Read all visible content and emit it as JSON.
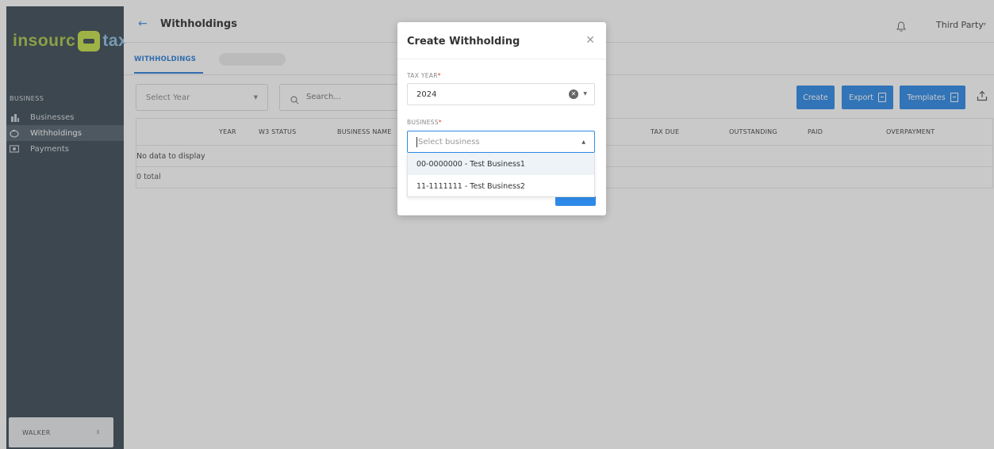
{
  "app": {
    "logo_text_1": "insourc",
    "logo_text_2": "tax",
    "brand_colors": {
      "sidebar": "#3d4b57",
      "accent": "#2f8ae8",
      "logo_green": "#c5e04a"
    }
  },
  "sidebar": {
    "section_label": "BUSINESS",
    "items": [
      {
        "label": "Businesses",
        "icon": "building-icon",
        "active": false
      },
      {
        "label": "Withholdings",
        "icon": "piggy-bank-icon",
        "active": true
      },
      {
        "label": "Payments",
        "icon": "money-icon",
        "active": false
      }
    ],
    "user": "WALKER"
  },
  "header": {
    "title": "Withholdings",
    "user_menu": "Third Party"
  },
  "tabs": [
    {
      "label": "WITHHOLDINGS",
      "active": true
    }
  ],
  "filters": {
    "year_placeholder": "Select Year",
    "search_placeholder": "Search..."
  },
  "toolbar": {
    "create_label": "Create",
    "export_label": "Export",
    "templates_label": "Templates"
  },
  "table": {
    "columns": [
      "YEAR",
      "W3 STATUS",
      "BUSINESS NAME",
      "TAX DUE",
      "OUTSTANDING",
      "PAID",
      "OVERPAYMENT"
    ],
    "empty_text": "No data to display",
    "total_text": "0 total"
  },
  "modal": {
    "title": "Create Withholding",
    "tax_year_label": "TAX YEAR",
    "tax_year_value": "2024",
    "business_label": "BUSINESS",
    "required_mark": "*",
    "business_placeholder": "Select business",
    "business_options": [
      "00-0000000 - Test Business1",
      "11-1111111 - Test Business2"
    ]
  }
}
